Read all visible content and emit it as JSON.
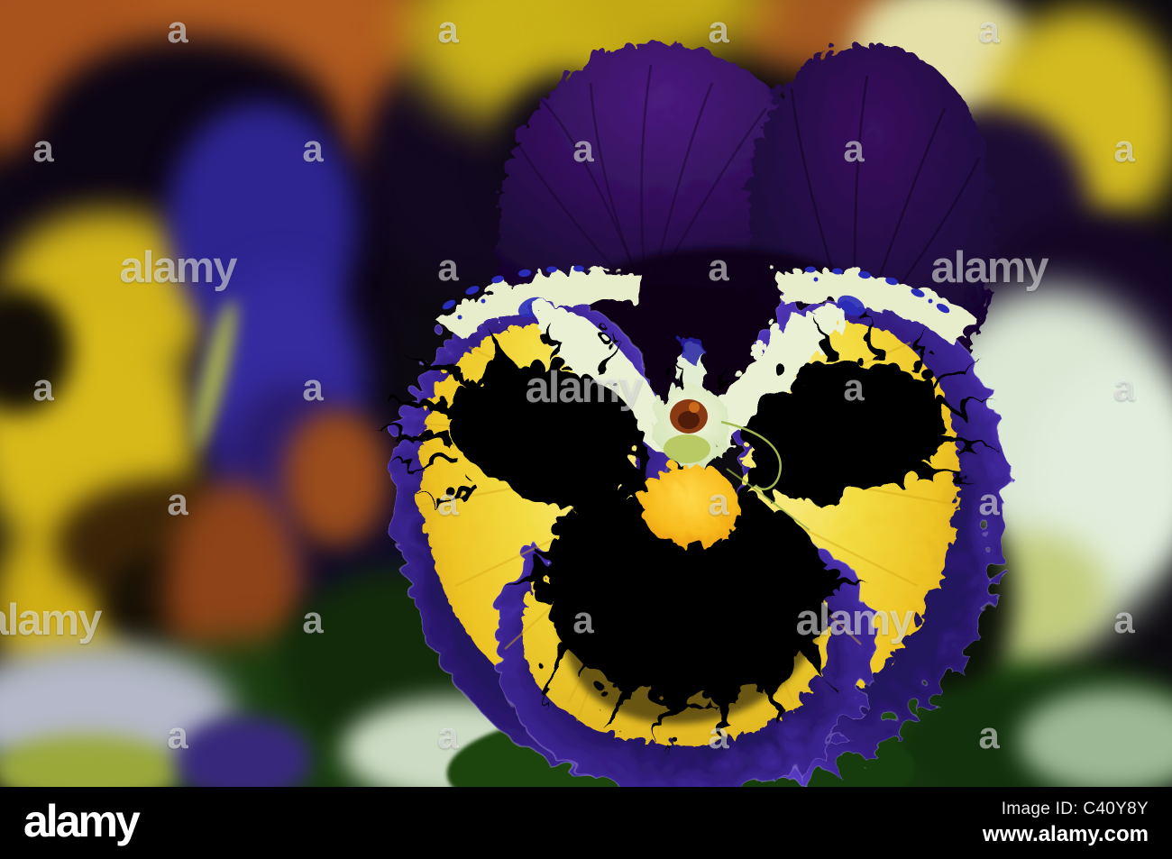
{
  "page": {
    "title": "Alamy watermarked stock photo preview"
  },
  "photo": {
    "subject": "Close-up of purple and yellow pansy flowers",
    "palette": {
      "deep_purple_petal": "#2c0a50",
      "violet_fringe": "#4a2ea6",
      "petal_yellow": "#f2d835",
      "blotch_black": "#060400",
      "cream_center": "#e9f0d4",
      "throat_orange": "#f7bc1c",
      "background_orange": "#a9531c",
      "foliage_green": "#1b3d10",
      "pale_flower": "#dbe8d4"
    }
  },
  "watermark": {
    "word": "alamy",
    "letter": "a"
  },
  "footer": {
    "brand": "alamy",
    "image_id": "Image ID: C40Y8Y",
    "website": "www.alamy.com"
  }
}
